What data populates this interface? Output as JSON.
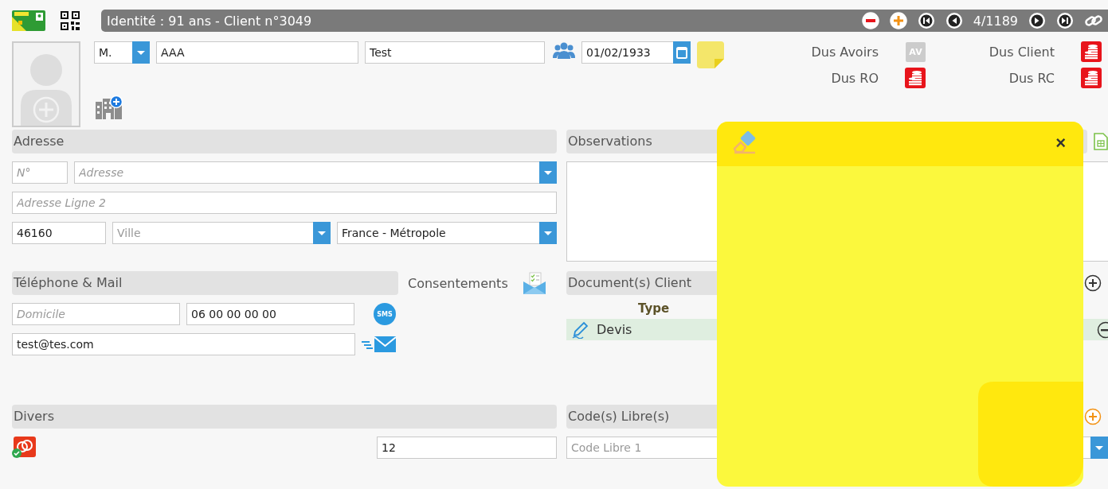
{
  "header": {
    "title": "Identité : 91 ans - Client n°3049",
    "pager": "4/1189"
  },
  "identity": {
    "civility": "M.",
    "last_name": "AAA",
    "first_name": "Test",
    "birth_date": "01/02/1933"
  },
  "dues": [
    {
      "label": "Dus Avoirs",
      "kind": "credit",
      "badge": "AV"
    },
    {
      "label": "Dus Client",
      "kind": "debt"
    },
    {
      "label": "Dus RO",
      "kind": "debt"
    },
    {
      "label": "Dus RC",
      "kind": "debt"
    }
  ],
  "address": {
    "title": "Adresse",
    "number_placeholder": "N°",
    "street_placeholder": "Adresse",
    "line2_placeholder": "Adresse Ligne 2",
    "postcode": "46160",
    "city_placeholder": "Ville",
    "country": "France - Métropole"
  },
  "contact": {
    "title": "Téléphone & Mail",
    "consent_label": "Consentements",
    "phone_placeholder": "Domicile",
    "phone": "06 00 00 00 00",
    "sms": "SMS",
    "email": "test@tes.com"
  },
  "observations": {
    "title": "Observations"
  },
  "documents": {
    "title": "Document(s) Client",
    "columns": [
      "Type"
    ],
    "rows": [
      {
        "type": "Devis",
        "selected": true
      }
    ]
  },
  "misc": {
    "title": "Divers",
    "value": "12"
  },
  "free_codes": {
    "title": "Code(s) Libre(s)",
    "placeholder": "Code Libre 1"
  },
  "sticky_note": {
    "close": "×"
  }
}
